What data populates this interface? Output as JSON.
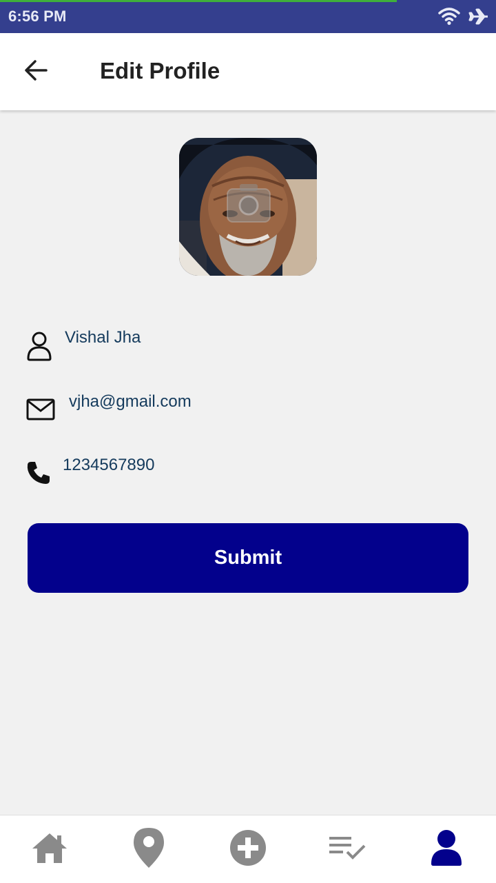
{
  "status_bar": {
    "time": "6:56 PM",
    "icons": [
      "wifi-icon",
      "airplane-icon"
    ],
    "progress": 0.8
  },
  "app_bar": {
    "title": "Edit Profile",
    "back_icon": "arrow-left-icon"
  },
  "profile": {
    "avatar_action_icon": "camera-icon",
    "fields": [
      {
        "icon": "user-icon",
        "value": "Vishal Jha"
      },
      {
        "icon": "mail-icon",
        "value": "vjha@gmail.com"
      },
      {
        "icon": "phone-icon",
        "value": "1234567890"
      }
    ]
  },
  "submit_label": "Submit",
  "bottom_nav": {
    "items": [
      {
        "icon": "home-icon",
        "active": false
      },
      {
        "icon": "location-pin-icon",
        "active": false
      },
      {
        "icon": "plus-circle-icon",
        "active": false
      },
      {
        "icon": "checklist-icon",
        "active": false
      },
      {
        "icon": "person-icon",
        "active": true
      }
    ]
  },
  "colors": {
    "status_bar": "#343f8e",
    "progress": "#3fb03b",
    "primary": "#03018c",
    "nav_inactive": "#8a8a8a",
    "nav_active": "#03018c",
    "field_text": "#143a5c",
    "background": "#f1f1f1"
  }
}
